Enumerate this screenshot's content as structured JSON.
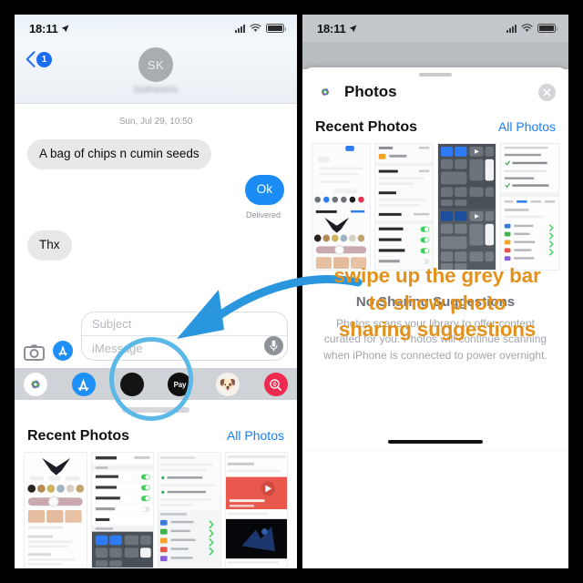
{
  "annotation": {
    "instruction_lines": [
      "swipe up the grey bar",
      "to show photo",
      "sharing suggestions"
    ],
    "text_color": "#E2921C",
    "arrow_color": "#2A96DE",
    "circle_color": "#5CB8E6",
    "circle_target": "grey-bar-drag-handle"
  },
  "left_phone": {
    "status_bar": {
      "time": "18:11",
      "location_icon": "location-arrow-icon",
      "cellular_icon": "cellular-signal-icon",
      "wifi_icon": "wifi-icon",
      "battery_icon": "battery-full-icon"
    },
    "messages_header": {
      "back_icon": "chevron-left-icon",
      "unread_badge": "1",
      "avatar_initials": "SK",
      "contact_name": "Sudhanshu"
    },
    "conversation": {
      "day_stamp": "Sun, Jul 29, 10:50",
      "messages": [
        {
          "side": "in",
          "text": "A bag of chips n cumin seeds"
        },
        {
          "side": "out",
          "text": "Ok",
          "status": "Delivered"
        },
        {
          "side": "in",
          "text": "Thx"
        }
      ]
    },
    "composer": {
      "camera_icon": "camera-icon",
      "appstore_icon": "app-store-icon",
      "subject_placeholder": "Subject",
      "message_placeholder": "iMessage",
      "mic_icon": "microphone-icon"
    },
    "app_drawer": {
      "apps": [
        {
          "name": "photos-app-icon",
          "label": "Photos"
        },
        {
          "name": "app-store-icon",
          "label": "App Store"
        },
        {
          "name": "store-app-icon",
          "label": "Store"
        },
        {
          "name": "apple-pay-icon",
          "label": "Pay"
        },
        {
          "name": "memoji-icon",
          "label": "Memoji"
        },
        {
          "name": "music-search-icon",
          "label": "Music"
        }
      ],
      "drag_handle": "grey-bar"
    },
    "photos_panel": {
      "title": "Recent Photos",
      "all_photos_link": "All Photos",
      "thumbnail_count": 4
    },
    "home_indicator": "home-indicator"
  },
  "right_phone": {
    "status_bar": {
      "time": "18:11",
      "location_icon": "location-arrow-icon",
      "cellular_icon": "cellular-signal-icon",
      "wifi_icon": "wifi-icon",
      "battery_icon": "battery-full-icon"
    },
    "sheet": {
      "grabber": "sheet-grabber",
      "app_icon": "photos-app-icon",
      "title": "Photos",
      "close_icon": "close-icon"
    },
    "photos_panel": {
      "title": "Recent Photos",
      "all_photos_link": "All Photos",
      "thumbnail_count": 4
    },
    "empty_state": {
      "title": "No Sharing Suggestions",
      "body": "Photos scans your library to offer content curated for you. Photos will continue scanning when iPhone is connected to power overnight."
    },
    "home_indicator": "home-indicator"
  }
}
